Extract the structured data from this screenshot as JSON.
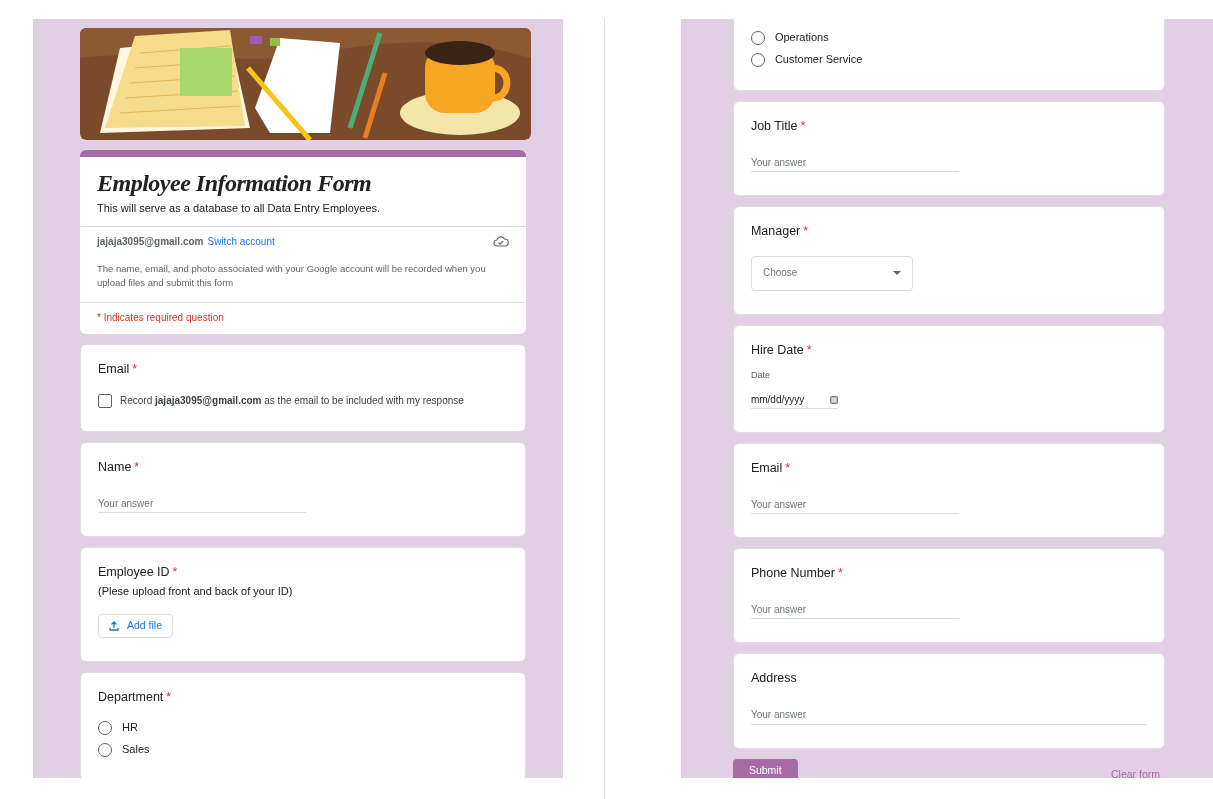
{
  "left_panel": {
    "header": {
      "title": "Employee Information Form",
      "description": "This will serve as a database to all Data Entry Employees.",
      "account_email": "jajaja3095@gmail.com",
      "switch_account": "Switch account",
      "notice": "The name, email, and photo associated with your Google account will be recorded when you upload files and submit this form",
      "required_note": "* Indicates required question"
    },
    "questions": [
      {
        "kind": "record_email",
        "title": "Email",
        "required_mark": "*",
        "checked": false,
        "text": "Record **jajaja3095@gmail.com** as the email to be included with my response"
      },
      {
        "kind": "text",
        "title": "Name",
        "required_mark": "*",
        "placeholder": "Your answer"
      },
      {
        "kind": "file",
        "title": "Employee ID",
        "required_mark": "*",
        "subtitle": "(Plese upload front and back of your ID)",
        "button": "Add file"
      },
      {
        "kind": "radio",
        "title": "Department",
        "required_mark": "*",
        "options": [
          {
            "label": "HR",
            "selected": false
          },
          {
            "label": "Sales",
            "selected": false
          }
        ]
      }
    ]
  },
  "right_panel": {
    "questions": [
      {
        "kind": "radio",
        "options": [
          {
            "label": "Operations",
            "selected": false
          },
          {
            "label": "Customer Service",
            "selected": false
          }
        ]
      },
      {
        "kind": "text",
        "title": "Job Title",
        "required_mark": "*",
        "placeholder": "Your answer"
      },
      {
        "kind": "select",
        "title": "Manager",
        "required_mark": "*",
        "placeholder": "Choose"
      },
      {
        "kind": "date",
        "title": "Hire Date",
        "required_mark": "*",
        "label": "Date",
        "placeholder": "mm/dd/yyyy"
      },
      {
        "kind": "text",
        "title": "Email",
        "required_mark": "*",
        "placeholder": "Your answer"
      },
      {
        "kind": "text",
        "title": "Phone Number",
        "required_mark": "*",
        "placeholder": "Your answer"
      },
      {
        "kind": "text",
        "title": "Address",
        "placeholder": "Your answer",
        "wide": true
      }
    ],
    "submit": "Submit",
    "clear": "Clear form"
  }
}
